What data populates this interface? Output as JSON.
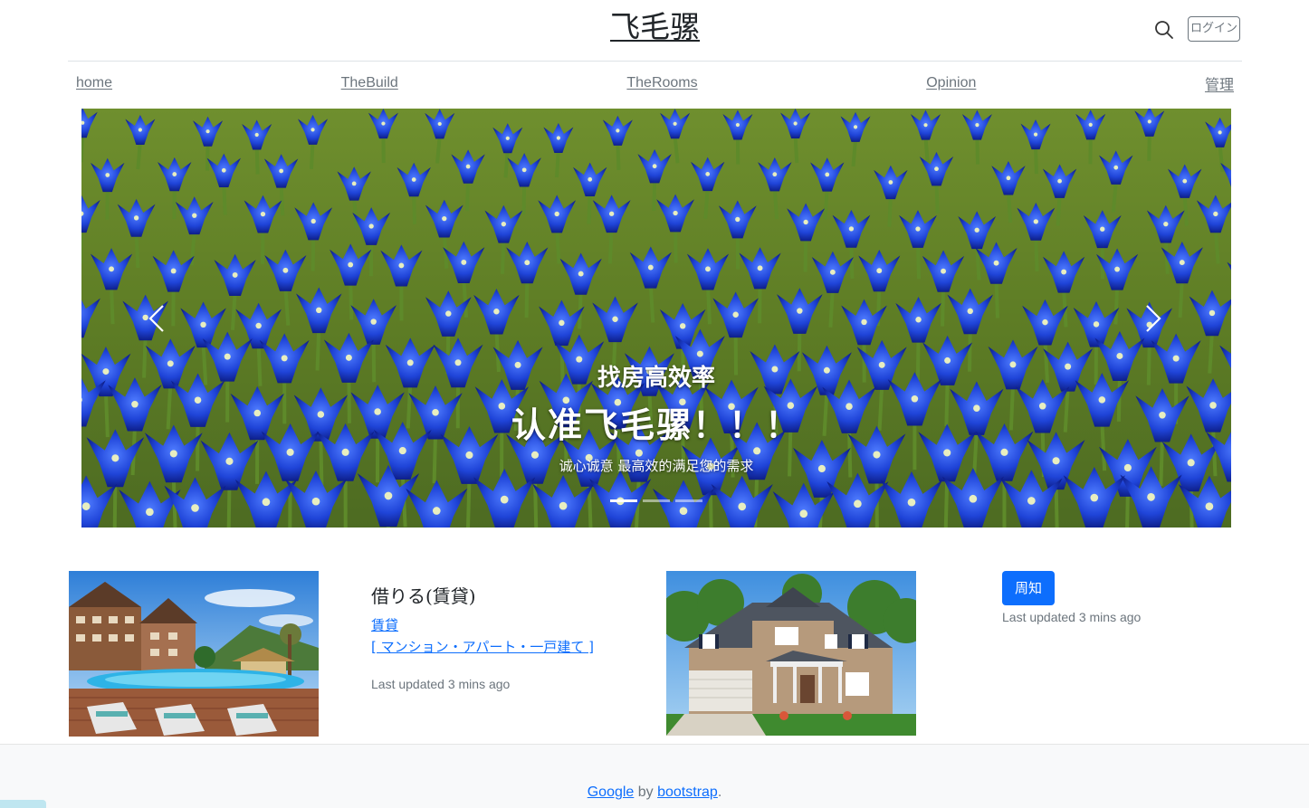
{
  "header": {
    "brand": "飞毛骡",
    "login_label": "ログイン"
  },
  "nav": {
    "items": [
      {
        "label": "home"
      },
      {
        "label": "TheBuild"
      },
      {
        "label": "TheRooms"
      },
      {
        "label": "Opinion"
      },
      {
        "label": "管理"
      }
    ]
  },
  "carousel": {
    "subtitle": "找房高效率",
    "title": "认准飞毛骡！！！",
    "description": "诚心诚意 最高效的满足您的需求",
    "slide_count": 3,
    "active_slide": 1
  },
  "content": {
    "card_title": "借りる(賃貸)",
    "link_1": "賃貸",
    "link_2": "[ マンション・アパート・一戸建て ]",
    "updated_1": "Last updated 3 mins ago",
    "notice_label": "周知",
    "updated_2": "Last updated 3 mins ago"
  },
  "footer": {
    "link_google": "Google",
    "by_text": " by ",
    "link_bootstrap": "bootstrap",
    "end_text": "."
  },
  "colors": {
    "primary": "#0d6efd",
    "muted": "#6c757d",
    "footer_bg": "#f8f9fa"
  },
  "icons": [
    "search-icon",
    "chevron-left-icon",
    "chevron-right-icon"
  ]
}
